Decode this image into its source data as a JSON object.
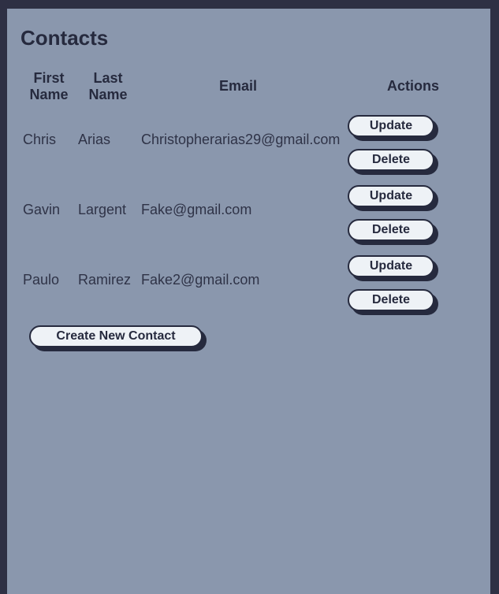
{
  "page_title": "Contacts",
  "table": {
    "headers": {
      "first_name_line1": "First",
      "first_name_line2": "Name",
      "last_name_line1": "Last",
      "last_name_line2": "Name",
      "email": "Email",
      "actions": "Actions"
    },
    "rows": [
      {
        "first": "Chris",
        "last": "Arias",
        "email": "Christopherarias29@gmail.com"
      },
      {
        "first": "Gavin",
        "last": "Largent",
        "email": "Fake@gmail.com"
      },
      {
        "first": "Paulo",
        "last": "Ramirez",
        "email": "Fake2@gmail.com"
      }
    ],
    "update_label": "Update",
    "delete_label": "Delete"
  },
  "create_button_label": "Create New Contact"
}
